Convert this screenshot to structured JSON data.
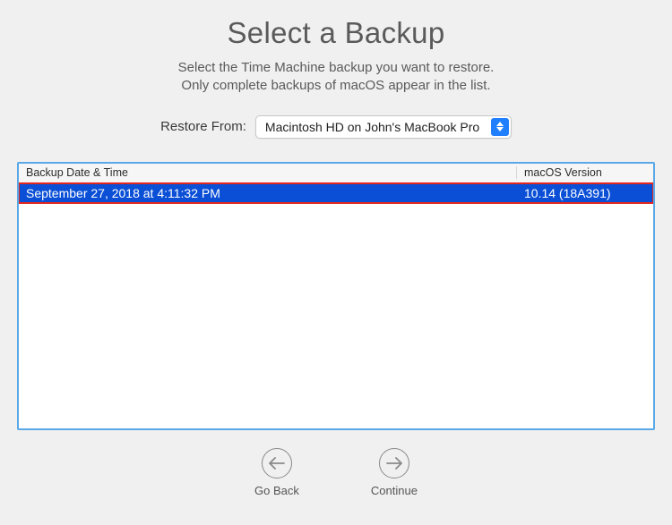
{
  "header": {
    "title": "Select a Backup",
    "subtitle_line1": "Select the Time Machine backup you want to restore.",
    "subtitle_line2": "Only complete backups of macOS appear in the list."
  },
  "restore": {
    "label": "Restore From:",
    "selected": "Macintosh HD on John's MacBook Pro"
  },
  "table": {
    "columns": {
      "date": "Backup Date & Time",
      "version": "macOS Version"
    },
    "rows": [
      {
        "date": "September 27, 2018 at 4:11:32 PM",
        "version": "10.14 (18A391)"
      }
    ]
  },
  "footer": {
    "back": "Go Back",
    "continue": "Continue"
  }
}
